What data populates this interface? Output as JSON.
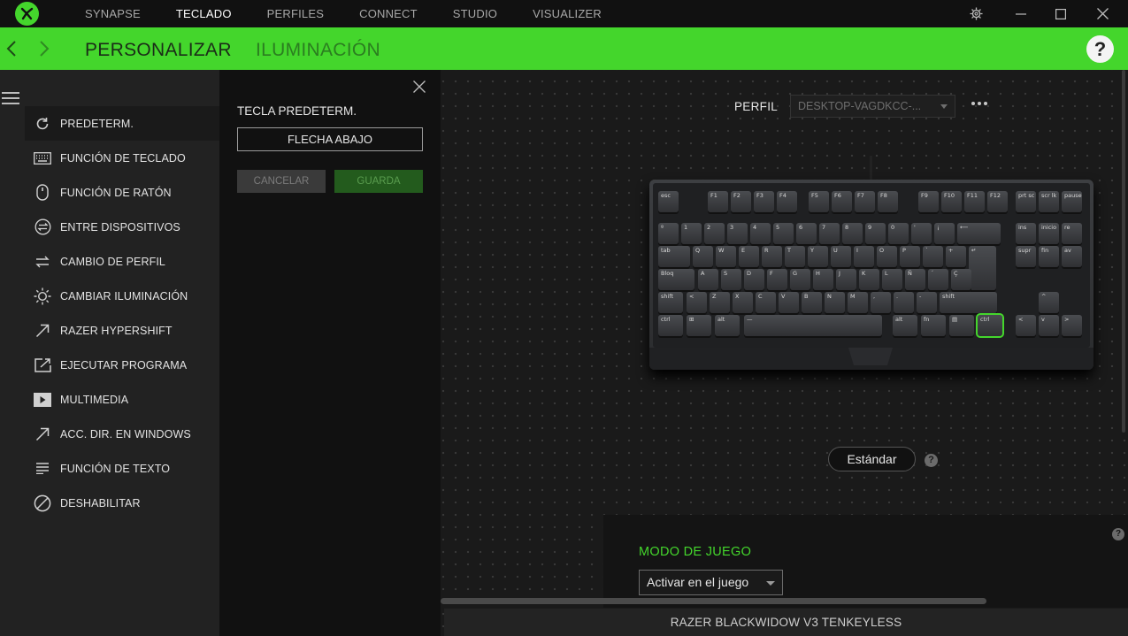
{
  "titlebar": {
    "tabs": [
      {
        "label": "SYNAPSE",
        "active": false
      },
      {
        "label": "TECLADO",
        "active": true
      },
      {
        "label": "PERFILES",
        "active": false
      },
      {
        "label": "CONNECT",
        "active": false
      },
      {
        "label": "STUDIO",
        "active": false
      },
      {
        "label": "VISUALIZER",
        "active": false
      }
    ]
  },
  "header": {
    "tabs": [
      {
        "label": "PERSONALIZAR",
        "active": true
      },
      {
        "label": "ILUMINACIÓN",
        "active": false
      }
    ],
    "help_label": "?"
  },
  "sidebar": {
    "items": [
      {
        "label": "PREDETERM.",
        "icon": "refresh-icon",
        "selected": true
      },
      {
        "label": "FUNCIÓN DE TECLADO",
        "icon": "keyboard-icon"
      },
      {
        "label": "FUNCIÓN DE RATÓN",
        "icon": "mouse-icon"
      },
      {
        "label": "ENTRE DISPOSITIVOS",
        "icon": "cross-device-icon"
      },
      {
        "label": "CAMBIO DE PERFIL",
        "icon": "swap-icon"
      },
      {
        "label": "CAMBIAR ILUMINACIÓN",
        "icon": "brightness-icon"
      },
      {
        "label": "RAZER HYPERSHIFT",
        "icon": "arrow-up-right-icon"
      },
      {
        "label": "EJECUTAR PROGRAMA",
        "icon": "launch-program-icon"
      },
      {
        "label": "MULTIMEDIA",
        "icon": "play-icon"
      },
      {
        "label": "ACC. DIR. EN WINDOWS",
        "icon": "shortcut-icon"
      },
      {
        "label": "FUNCIÓN DE TEXTO",
        "icon": "text-lines-icon"
      },
      {
        "label": "DESHABILITAR",
        "icon": "disable-icon"
      }
    ]
  },
  "config": {
    "title": "TECLA PREDETERM.",
    "key_value": "FLECHA ABAJO",
    "cancel_label": "CANCELAR",
    "save_label": "GUARDA"
  },
  "main": {
    "profile_label": "PERFIL",
    "profile_value": "DESKTOP-VAGDKCC-...",
    "mode_label": "Estándar",
    "help_label": "?"
  },
  "game_mode": {
    "title": "MODO DE JUEGO",
    "select_value": "Activar en el juego",
    "help_label": "?"
  },
  "device": {
    "name": "RAZER BLACKWIDOW V3 TENKEYLESS"
  },
  "keyboard": {
    "selected_key": "down-arrow",
    "keys": [
      {
        "label": "esc"
      },
      {
        "label": "F1"
      },
      {
        "label": "F2"
      },
      {
        "label": "F3"
      },
      {
        "label": "F4"
      },
      {
        "label": "F5"
      },
      {
        "label": "F6"
      },
      {
        "label": "F7"
      },
      {
        "label": "F8"
      },
      {
        "label": "F9"
      },
      {
        "label": "F10"
      },
      {
        "label": "F11"
      },
      {
        "label": "F12"
      },
      {
        "label": "prt sc"
      },
      {
        "label": "scr lk"
      },
      {
        "label": "pause"
      },
      {
        "label": "º"
      },
      {
        "label": "1"
      },
      {
        "label": "2"
      },
      {
        "label": "3"
      },
      {
        "label": "4"
      },
      {
        "label": "5"
      },
      {
        "label": "6"
      },
      {
        "label": "7"
      },
      {
        "label": "8"
      },
      {
        "label": "9"
      },
      {
        "label": "0"
      },
      {
        "label": "'"
      },
      {
        "label": "¡"
      },
      {
        "label": "⟵"
      },
      {
        "label": "ins"
      },
      {
        "label": "inicio"
      },
      {
        "label": "re"
      },
      {
        "label": "tab"
      },
      {
        "label": "Q"
      },
      {
        "label": "W"
      },
      {
        "label": "E"
      },
      {
        "label": "R"
      },
      {
        "label": "T"
      },
      {
        "label": "Y"
      },
      {
        "label": "U"
      },
      {
        "label": "I"
      },
      {
        "label": "O"
      },
      {
        "label": "P"
      },
      {
        "label": "`"
      },
      {
        "label": "+"
      },
      {
        "label": "↵"
      },
      {
        "label": "supr"
      },
      {
        "label": "fin"
      },
      {
        "label": "av"
      },
      {
        "label": "Bloq"
      },
      {
        "label": "A"
      },
      {
        "label": "S"
      },
      {
        "label": "D"
      },
      {
        "label": "F"
      },
      {
        "label": "G"
      },
      {
        "label": "H"
      },
      {
        "label": "J"
      },
      {
        "label": "K"
      },
      {
        "label": "L"
      },
      {
        "label": "Ñ"
      },
      {
        "label": "´"
      },
      {
        "label": "Ç"
      },
      {
        "label": "shift"
      },
      {
        "label": "<"
      },
      {
        "label": "Z"
      },
      {
        "label": "X"
      },
      {
        "label": "C"
      },
      {
        "label": "V"
      },
      {
        "label": "B"
      },
      {
        "label": "N"
      },
      {
        "label": "M"
      },
      {
        "label": ","
      },
      {
        "label": "."
      },
      {
        "label": "-"
      },
      {
        "label": "shift"
      },
      {
        "label": "^"
      },
      {
        "label": "ctrl"
      },
      {
        "label": "⊞"
      },
      {
        "label": "alt"
      },
      {
        "label": "—"
      },
      {
        "label": "alt"
      },
      {
        "label": "fn"
      },
      {
        "label": "▤"
      },
      {
        "label": "ctrl"
      },
      {
        "label": "<"
      },
      {
        "label": "v"
      },
      {
        "label": ">"
      }
    ]
  },
  "colors": {
    "accent": "#44d62c",
    "background": "#1a1a1a",
    "menu_bg": "#222222",
    "panel_bg": "#111111"
  }
}
